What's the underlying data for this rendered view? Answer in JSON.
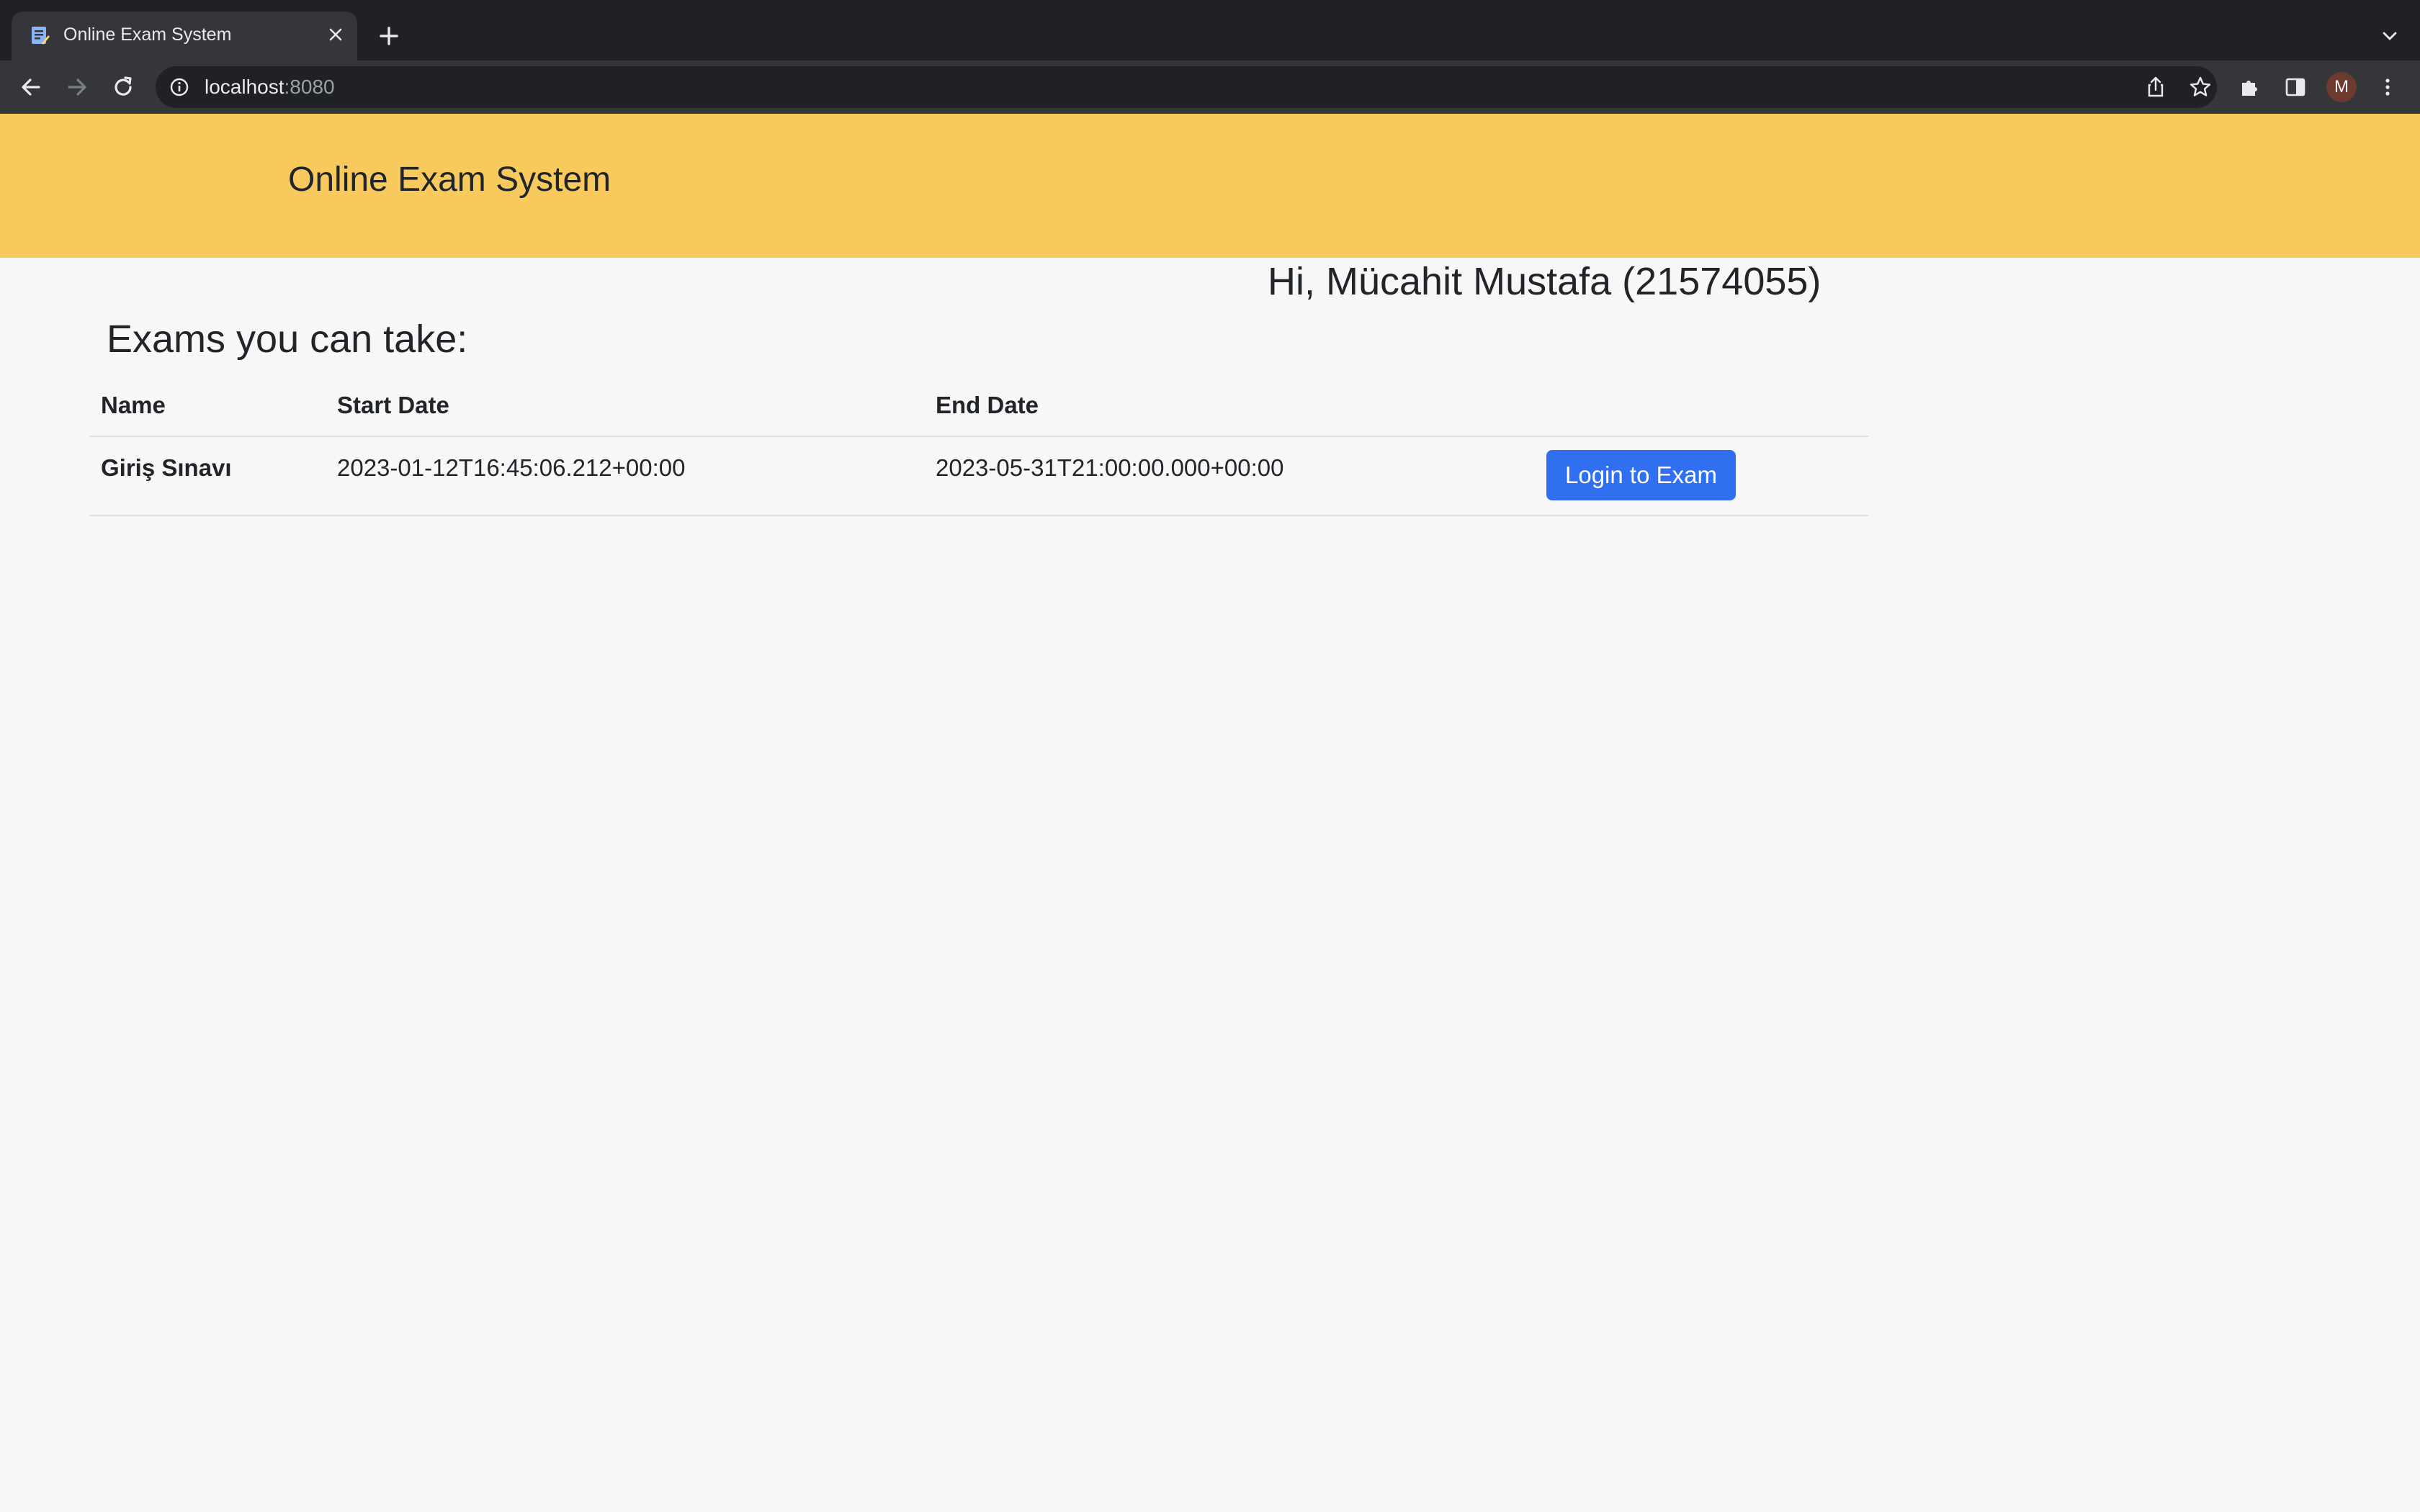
{
  "browser": {
    "tab_title": "Online Exam System",
    "url_host": "localhost",
    "url_port": ":8080",
    "profile_initial": "M"
  },
  "header": {
    "brand": "Online Exam System"
  },
  "user": {
    "greeting": "Hi, Mücahit Mustafa (21574055)"
  },
  "exams": {
    "title": "Exams you can take:",
    "columns": [
      "Name",
      "Start Date",
      "End Date",
      ""
    ],
    "rows": [
      {
        "name": "Giriş Sınavı",
        "start": "2023-01-12T16:45:06.212+00:00",
        "end": "2023-05-31T21:00:00.000+00:00",
        "action": "Login to Exam"
      }
    ]
  },
  "colors": {
    "header_bg": "#f8ca5e",
    "page_bg": "#f7f7f7",
    "primary_button": "#2f6ff0"
  }
}
